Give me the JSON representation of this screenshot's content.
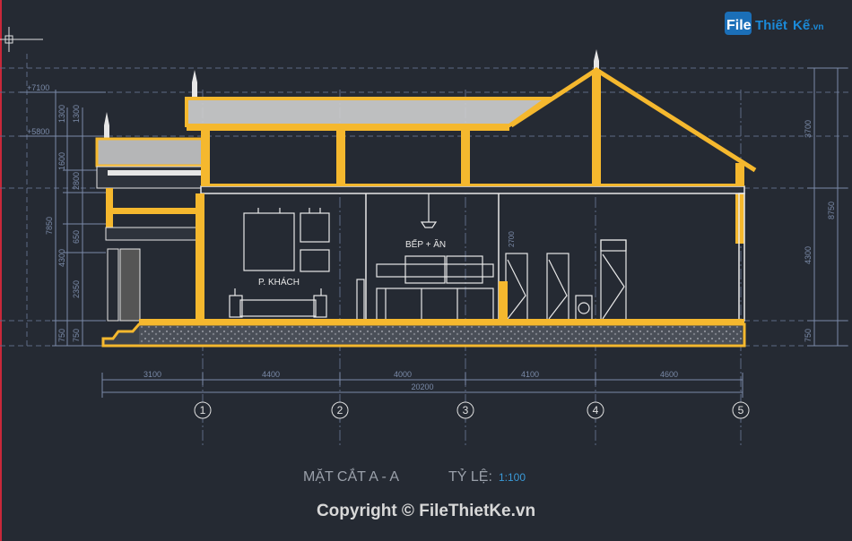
{
  "brand": {
    "file": "File",
    "thiet": "Thiết",
    "ke": "Kế",
    "vn": ".vn"
  },
  "levels": {
    "l1": "+7100",
    "l2": "+5800"
  },
  "left_dims": [
    "1300",
    "1300",
    "1600",
    "2800",
    "7850",
    "650",
    "4300",
    "2350",
    "750",
    "750"
  ],
  "right_dims": [
    "3700",
    "8750",
    "4300",
    "750"
  ],
  "rooms": {
    "living": "P. KHÁCH",
    "kitchen": "BẾP + ĂN",
    "height_2700": "2700"
  },
  "bottom_dims": {
    "spans": [
      "3100",
      "4400",
      "4000",
      "4100",
      "4600"
    ],
    "total": "20200"
  },
  "axes": [
    "1",
    "2",
    "3",
    "4",
    "5"
  ],
  "title": {
    "section": "MẶT CẮT A - A",
    "scale_label": "TỶ LỆ:",
    "scale_value": "1:100"
  },
  "copyright": "Copyright © FileThietKe.vn",
  "colors": {
    "background": "#252a33",
    "structure": "#f5b82e",
    "lines": "#e8e8e8",
    "dims": "#7a8aa8",
    "scale": "#3a9ad8"
  }
}
